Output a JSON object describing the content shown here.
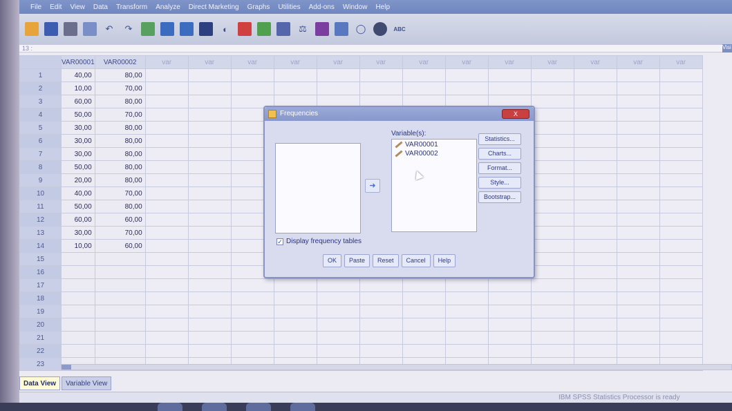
{
  "menu": [
    "File",
    "Edit",
    "View",
    "Data",
    "Transform",
    "Analyze",
    "Direct Marketing",
    "Graphs",
    "Utilities",
    "Add-ons",
    "Window",
    "Help"
  ],
  "cell_ref": "13 :",
  "visible_label": "Visi",
  "columns": [
    "VAR00001",
    "VAR00002",
    "var",
    "var",
    "var",
    "var",
    "var",
    "var",
    "var",
    "var",
    "var",
    "var",
    "var",
    "var",
    "var"
  ],
  "rows": [
    {
      "n": "1",
      "a": "40,00",
      "b": "80,00"
    },
    {
      "n": "2",
      "a": "10,00",
      "b": "70,00"
    },
    {
      "n": "3",
      "a": "60,00",
      "b": "80,00"
    },
    {
      "n": "4",
      "a": "50,00",
      "b": "70,00"
    },
    {
      "n": "5",
      "a": "30,00",
      "b": "80,00"
    },
    {
      "n": "6",
      "a": "30,00",
      "b": "80,00"
    },
    {
      "n": "7",
      "a": "30,00",
      "b": "80,00"
    },
    {
      "n": "8",
      "a": "50,00",
      "b": "80,00"
    },
    {
      "n": "9",
      "a": "20,00",
      "b": "80,00"
    },
    {
      "n": "10",
      "a": "40,00",
      "b": "70,00"
    },
    {
      "n": "11",
      "a": "50,00",
      "b": "80,00"
    },
    {
      "n": "12",
      "a": "60,00",
      "b": "60,00"
    },
    {
      "n": "13",
      "a": "30,00",
      "b": "70,00"
    },
    {
      "n": "14",
      "a": "10,00",
      "b": "60,00"
    },
    {
      "n": "15",
      "a": "",
      "b": ""
    },
    {
      "n": "16",
      "a": "",
      "b": ""
    },
    {
      "n": "17",
      "a": "",
      "b": ""
    },
    {
      "n": "18",
      "a": "",
      "b": ""
    },
    {
      "n": "19",
      "a": "",
      "b": ""
    },
    {
      "n": "20",
      "a": "",
      "b": ""
    },
    {
      "n": "21",
      "a": "",
      "b": ""
    },
    {
      "n": "22",
      "a": "",
      "b": ""
    },
    {
      "n": "23",
      "a": "",
      "b": ""
    }
  ],
  "tabs": {
    "data_view": "Data View",
    "variable_view": "Variable View"
  },
  "status": "IBM SPSS Statistics Processor is ready",
  "dialog": {
    "title": "Frequencies",
    "close": "X",
    "variables_label": "Variable(s):",
    "selected_variables": [
      "VAR00001",
      "VAR00002"
    ],
    "side_buttons": [
      "Statistics...",
      "Charts...",
      "Format...",
      "Style...",
      "Bootstrap..."
    ],
    "display_freq_label": "Display frequency tables",
    "display_freq_checked": true,
    "bottom_buttons": [
      "OK",
      "Paste",
      "Reset",
      "Cancel",
      "Help"
    ]
  }
}
